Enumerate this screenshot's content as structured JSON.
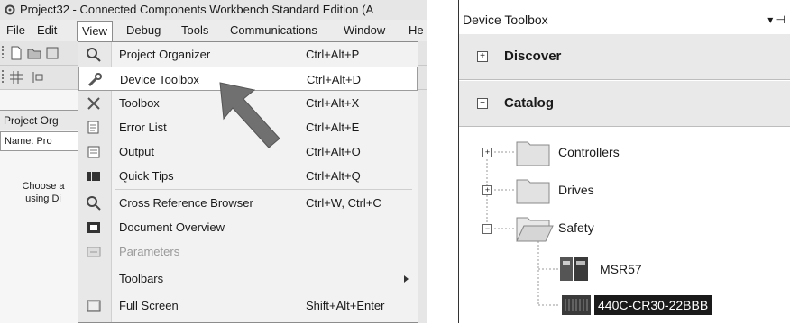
{
  "window": {
    "title": "Project32 - Connected Components Workbench Standard Edition (A"
  },
  "menubar": {
    "items": [
      "File",
      "Edit",
      "View",
      "Debug",
      "Tools",
      "Communications",
      "Window",
      "He"
    ]
  },
  "side_panel": {
    "header": "Project Org",
    "name_field": "Name: Pro",
    "hint": "Choose a\nusing Di"
  },
  "view_menu": {
    "items": [
      {
        "label": "Project Organizer",
        "shortcut": "Ctrl+Alt+P",
        "icon": "magnifier-icon"
      },
      {
        "label": "Device Toolbox",
        "shortcut": "Ctrl+Alt+D",
        "icon": "wrench-icon",
        "highlighted": true
      },
      {
        "label": "Toolbox",
        "shortcut": "Ctrl+Alt+X",
        "icon": "tools-icon"
      },
      {
        "label": "Error List",
        "shortcut": "Ctrl+Alt+E",
        "icon": "error-list-icon"
      },
      {
        "label": "Output",
        "shortcut": "Ctrl+Alt+O",
        "icon": "output-icon"
      },
      {
        "label": "Quick Tips",
        "shortcut": "Ctrl+Alt+Q",
        "icon": "quick-tips-icon"
      },
      {
        "label": "Cross Reference Browser",
        "shortcut": "Ctrl+W, Ctrl+C",
        "icon": "magnifier-icon"
      },
      {
        "label": "Document Overview",
        "shortcut": "",
        "icon": "document-icon"
      },
      {
        "label": "Parameters",
        "shortcut": "",
        "icon": "parameters-icon",
        "disabled": true
      },
      {
        "label": "Toolbars",
        "shortcut": "",
        "icon": "",
        "submenu": true
      },
      {
        "label": "Full Screen",
        "shortcut": "Shift+Alt+Enter",
        "icon": "fullscreen-icon"
      }
    ]
  },
  "device_toolbox": {
    "title": "Device Toolbox",
    "pin_glyph": "▾ ⊣",
    "sections": [
      {
        "label": "Discover",
        "expander": "+"
      },
      {
        "label": "Catalog",
        "expander": "−"
      }
    ],
    "tree": [
      {
        "label": "Controllers",
        "expander": "+"
      },
      {
        "label": "Drives",
        "expander": "+"
      },
      {
        "label": "Safety",
        "expander": "−"
      },
      {
        "label": "MSR57"
      },
      {
        "label": "440C-CR30-22BBB",
        "selected": true
      }
    ]
  }
}
